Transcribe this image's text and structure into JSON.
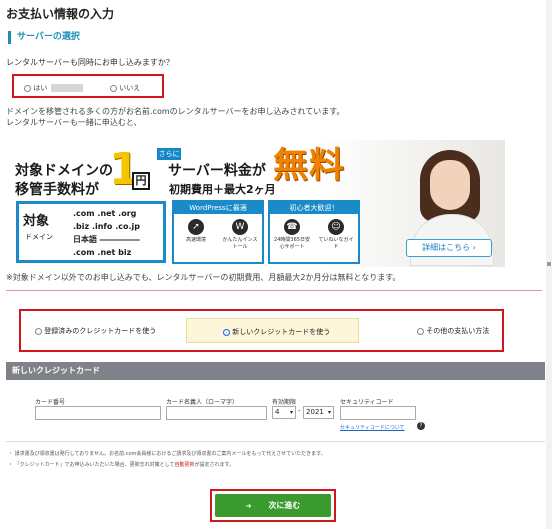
{
  "page_title": "お支払い情報の入力",
  "server_section": {
    "heading": "サーバーの選択",
    "question": "レンタルサーバーも同時にお申し込みますか？",
    "options": {
      "yes": "はい",
      "no": "いいえ"
    }
  },
  "note1": {
    "line1": "ドメインを移管される多くの方がお名前.comのレンタルサーバーをお申し込みされています。",
    "line2": "レンタルサーバーも一緒に申込むと、"
  },
  "banner": {
    "title_line1": "対象ドメインの",
    "title_line2": "移管手数料が",
    "one": "1",
    "yen": "円",
    "sarani": "さらに",
    "fee_line1": "サーバー料金が",
    "fee_line2": "初期費用＋最大2ヶ月",
    "free": "無料",
    "taisho": "対象",
    "domain_label": "ドメイン",
    "tlds": [
      ".com  .net  .org",
      ".biz  .info  .co.jp",
      "日本語 ―――――",
      ".com  .net  biz"
    ],
    "feature1": {
      "heading": "WordPressに最適",
      "items": [
        "高速環境",
        "かんたんインストール"
      ]
    },
    "feature2": {
      "heading": "初心者大歓迎！",
      "items": [
        "24時間365日安心サポート",
        "ていねいなガイド"
      ]
    },
    "more_label": "詳細はこちら"
  },
  "note2": "※対象ドメイン以外でのお申し込みでも、レンタルサーバーの初期費用、月額最大2か月分は無料となります。",
  "payment": {
    "options": [
      "登録済みのクレジットカードを使う",
      "新しいクレジットカードを使う",
      "その他の支払い方法"
    ],
    "selected_index": 1
  },
  "card": {
    "header": "新しいクレジットカード",
    "number_label": "カード番号",
    "name_label": "カード名義人（ローマ字）",
    "expiry_label": "有効期限",
    "expiry_month": "4",
    "expiry_dash": "-",
    "expiry_year": "2021",
    "security_label": "セキュリティコード",
    "security_link": "セキュリティコードについて",
    "help_icon": "?"
  },
  "notes3": {
    "line1": "・ 請求書及び領収書は発行しておりません。お名前.com会員様におけるご請求及び領収書のご案内メールをもって代えさせていただきます。",
    "line2_prefix": "・ 「クレジットカード」でお申込みいただいた場合、更新忘れ対策として",
    "line2_red": "自動更新",
    "line2_suffix": "が設定されます。"
  },
  "next_button": {
    "arrow": "➜",
    "label": "次に進む",
    "color": "#3a9a2d"
  },
  "colors": {
    "accent": "#1b8fb5",
    "highlight_border": "#d0161f",
    "free": "#f08200",
    "one": "#f7c400"
  }
}
